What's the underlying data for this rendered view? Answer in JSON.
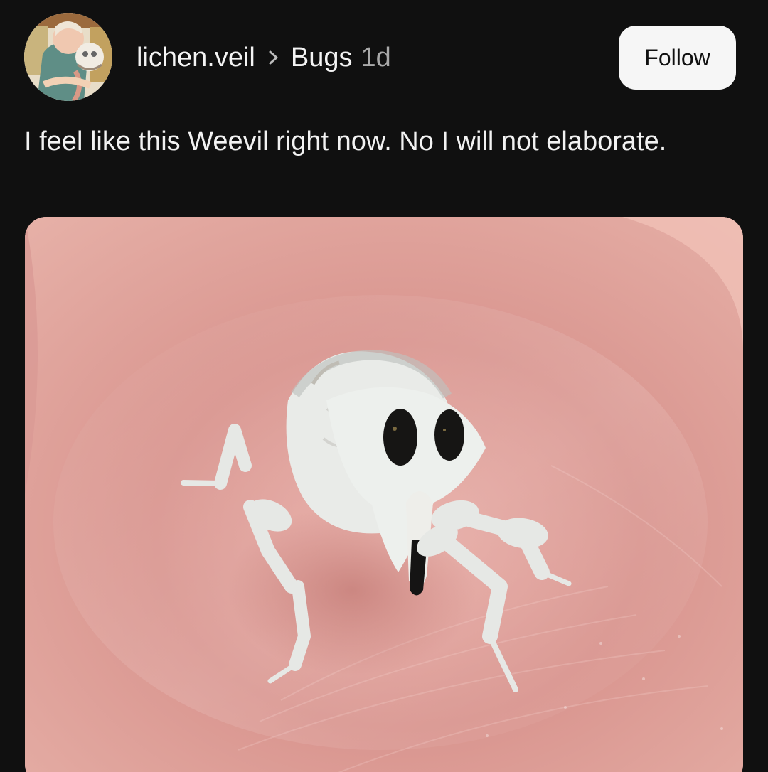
{
  "post": {
    "author": {
      "username": "lichen.veil",
      "avatar_icon": "illustrated-avatar"
    },
    "separator_icon": "chevron-right-icon",
    "community": "Bugs",
    "timestamp": "1d",
    "follow_label": "Follow",
    "body": "I feel like this Weevil right now. No I will not elaborate.",
    "image": {
      "subject_icon": "weevil-photo"
    }
  },
  "theme": {
    "background": "#101010",
    "text": "#f2f2f2",
    "muted_text": "#a9a9a9",
    "follow_button": "#f6f6f6"
  }
}
